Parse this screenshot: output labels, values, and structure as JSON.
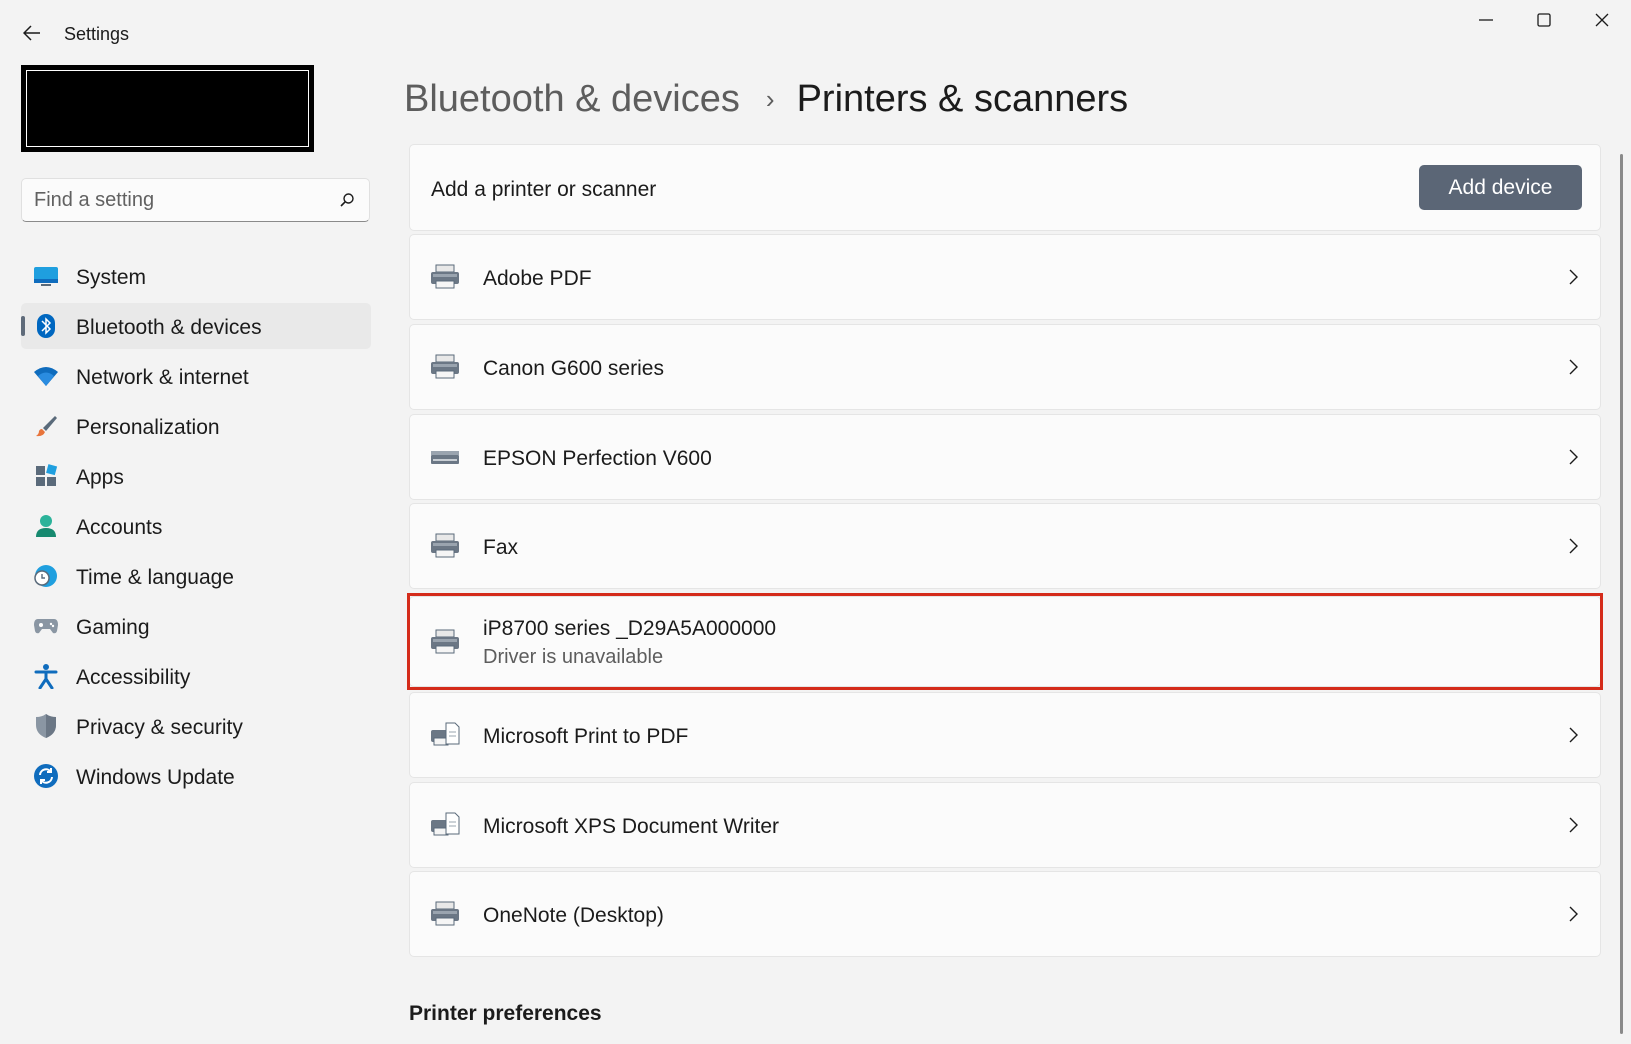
{
  "window": {
    "title": "Settings"
  },
  "search": {
    "placeholder": "Find a setting"
  },
  "nav": {
    "items": [
      {
        "label": "System",
        "icon": "monitor-icon"
      },
      {
        "label": "Bluetooth & devices",
        "icon": "bluetooth-icon",
        "active": true
      },
      {
        "label": "Network & internet",
        "icon": "wifi-icon"
      },
      {
        "label": "Personalization",
        "icon": "brush-icon"
      },
      {
        "label": "Apps",
        "icon": "apps-icon"
      },
      {
        "label": "Accounts",
        "icon": "person-icon"
      },
      {
        "label": "Time & language",
        "icon": "globe-clock-icon"
      },
      {
        "label": "Gaming",
        "icon": "gamepad-icon"
      },
      {
        "label": "Accessibility",
        "icon": "accessibility-icon"
      },
      {
        "label": "Privacy & security",
        "icon": "shield-icon"
      },
      {
        "label": "Windows Update",
        "icon": "sync-icon"
      }
    ]
  },
  "breadcrumb": {
    "parent": "Bluetooth & devices",
    "separator": "›",
    "current": "Printers & scanners"
  },
  "add": {
    "label": "Add a printer or scanner",
    "button": "Add device"
  },
  "devices": [
    {
      "name": "Adobe PDF",
      "icon": "printer-icon"
    },
    {
      "name": "Canon G600 series",
      "icon": "printer-icon"
    },
    {
      "name": "EPSON Perfection V600",
      "icon": "scanner-icon"
    },
    {
      "name": "Fax",
      "icon": "printer-icon"
    },
    {
      "name": "iP8700 series _D29A5A000000",
      "status": "Driver is unavailable",
      "icon": "printer-icon",
      "highlighted": true
    },
    {
      "name": "Microsoft Print to PDF",
      "icon": "printer-document-icon"
    },
    {
      "name": "Microsoft XPS Document Writer",
      "icon": "printer-document-icon"
    },
    {
      "name": "OneNote (Desktop)",
      "icon": "printer-icon"
    }
  ],
  "sections": {
    "preferences": "Printer preferences"
  },
  "colors": {
    "accent": "#5b6676",
    "highlight": "#d42b1a",
    "bluetooth": "#0067c0"
  }
}
